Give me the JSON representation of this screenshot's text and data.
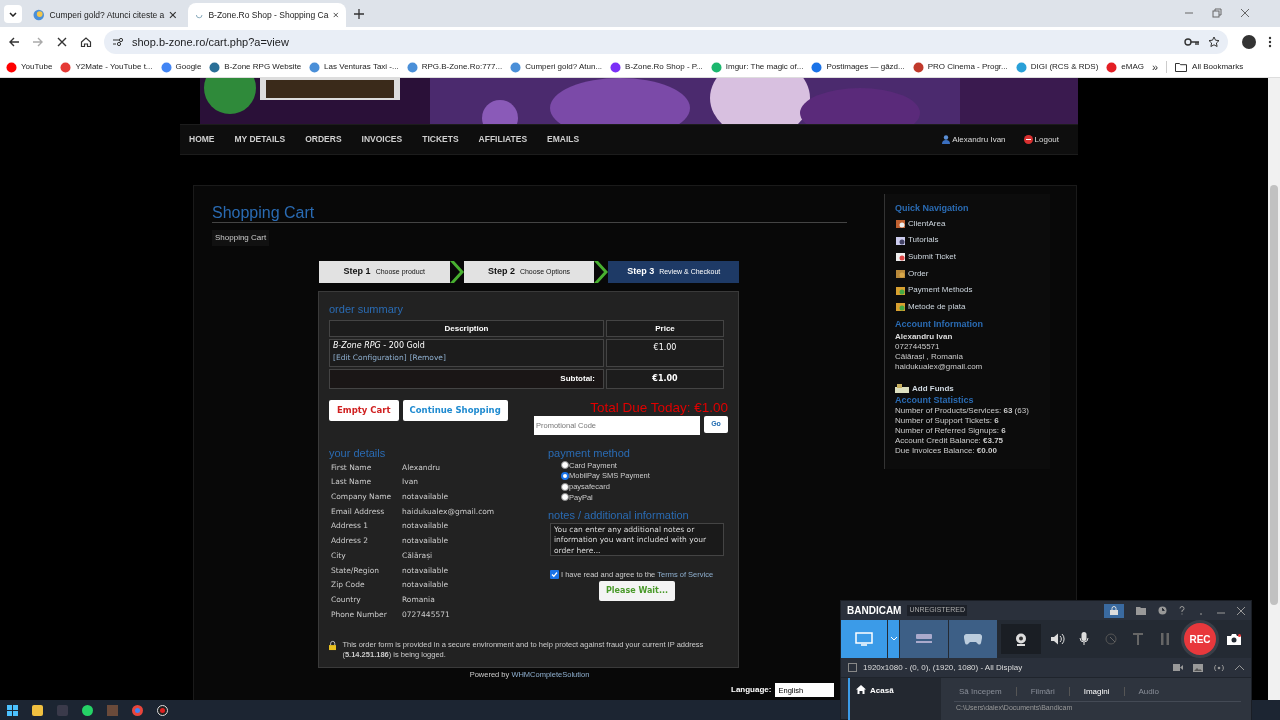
{
  "browser": {
    "tabs": [
      {
        "title": "Cumperi gold? Atunci citeste a",
        "selected": false
      },
      {
        "title": "B-Zone.Ro Shop - Shopping Ca",
        "selected": true
      }
    ],
    "url": "shop.b-zone.ro/cart.php?a=view",
    "bookmarks": [
      "YouTube",
      "Y2Mate - YouTube t...",
      "Google",
      "B-Zone RPG Website",
      "Las Venturas Taxi -...",
      "RPG.B-Zone.Ro:777...",
      "Cumperi gold? Atun...",
      "B-Zone.Ro Shop - P...",
      "Imgur: The magic of...",
      "Postimages — găzd...",
      "PRO Cinema - Progr...",
      "DIGI (RCS & RDS)",
      "eMAG"
    ],
    "bookmarks_more": "»",
    "all_bookmarks": "All Bookmarks"
  },
  "site": {
    "nav": [
      "HOME",
      "MY DETAILS",
      "ORDERS",
      "INVOICES",
      "TICKETS",
      "AFFILIATES",
      "EMAILS"
    ],
    "user": "Alexandru Ivan",
    "logout": "Logout"
  },
  "page_title": "Shopping Cart",
  "breadcrumb": "Shopping Cart",
  "steps": [
    {
      "number": "Step 1",
      "label": "Choose product",
      "selected": false
    },
    {
      "number": "Step 2",
      "label": "Choose Options",
      "selected": false
    },
    {
      "number": "Step 3",
      "label": "Review & Checkout",
      "selected": true
    }
  ],
  "order_summary": {
    "heading": "order summary",
    "columns": [
      "Description",
      "Price"
    ],
    "item": {
      "name": "*B-Zone RPG* - 200 Gold",
      "links": [
        "[Edit Configuration]",
        "[Remove]"
      ],
      "price": "€1.00"
    },
    "subtotal_label": "Subtotal:",
    "subtotal": "€1.00"
  },
  "actions": {
    "empty_cart": "Empty Cart",
    "continue_shopping": "Continue Shopping",
    "total": "Total Due Today: €1.00",
    "promo_placeholder": "Promotional Code",
    "go": "Go"
  },
  "your_details": {
    "heading": "your details",
    "fields": [
      {
        "label": "First Name",
        "value": "Alexandru"
      },
      {
        "label": "Last Name",
        "value": "Ivan"
      },
      {
        "label": "Company Name",
        "value": "notavailable"
      },
      {
        "label": "Email Address",
        "value": "haidukualex@gmail.com"
      },
      {
        "label": "Address 1",
        "value": "notavailable"
      },
      {
        "label": "Address 2",
        "value": "notavailable"
      },
      {
        "label": "City",
        "value": "Călărași"
      },
      {
        "label": "State/Region",
        "value": "notavailable"
      },
      {
        "label": "Zip Code",
        "value": "notavailable"
      },
      {
        "label": "Country",
        "value": "Romania"
      },
      {
        "label": "Phone Number",
        "value": "0727445571"
      }
    ]
  },
  "payment_method": {
    "heading": "payment method",
    "options": [
      {
        "label": "Card Payment",
        "selected": false
      },
      {
        "label": "MobilPay SMS Payment",
        "selected": true
      },
      {
        "label": "paysafecard",
        "selected": false
      },
      {
        "label": "PayPal",
        "selected": false
      }
    ]
  },
  "notes": {
    "heading": "notes / additional information",
    "placeholder": "You can enter any additional notes or information you want included with your order here..."
  },
  "tos": {
    "checked": true,
    "text": "I have read and agree to the",
    "link": "Terms of Service"
  },
  "submit": "Please Wait...",
  "secure_notice": "This order form is provided in a secure environment and to help protect against fraud your current IP address (**5.14.251.186**) is being logged.",
  "footer": {
    "powered": "Powered by",
    "link": "WHMCompleteSolution",
    "language_label": "Language:",
    "language": "English"
  },
  "sidebar": {
    "quick_nav_heading": "Quick Navigation",
    "quick_nav": [
      "ClientArea",
      "Tutorials",
      "Submit Ticket",
      "Order",
      "Payment Methods",
      "Metode de plata"
    ],
    "account_heading": "Account Information",
    "name": "Alexandru Ivan",
    "phone": "0727445571",
    "location": "Călărași , Romania",
    "email": "haidukualex@gmail.com",
    "add_funds": "Add Funds",
    "stats_heading": "Account Statistics",
    "stats": [
      "Number of Products/Services: **63** (63)",
      "Number of Support Tickets: **6**",
      "Number of Referred Signups: **6**",
      "Account Credit Balance: **€3.75**",
      "Due Invoices Balance: **€0.00**"
    ]
  },
  "bandicam": {
    "brand": "BANDICAM",
    "badge": "UNREGISTERED",
    "rec": "REC",
    "area_checked": false,
    "area": "1920x1080 - (0, 0), (1920, 1080) - All Display",
    "home": "Acasă",
    "tabs": [
      {
        "label": "Să începem",
        "selected": false
      },
      {
        "label": "Filmări",
        "selected": false
      },
      {
        "label": "Imagini",
        "selected": true
      },
      {
        "label": "Audio",
        "selected": false
      }
    ],
    "path": "C:\\Users\\dalex\\Documents\\Bandicam"
  }
}
